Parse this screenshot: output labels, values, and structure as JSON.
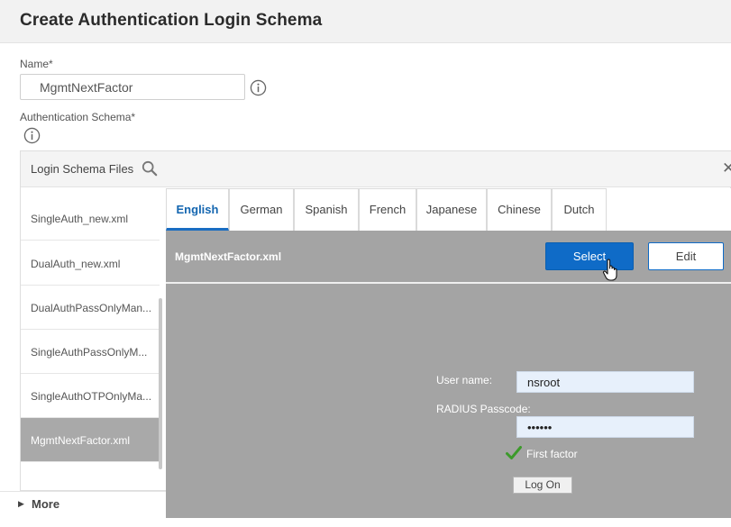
{
  "header": {
    "title": "Create Authentication Login Schema"
  },
  "form": {
    "name_label": "Name*",
    "name_value": "MgmtNextFactor",
    "schema_label": "Authentication Schema*"
  },
  "schema_panel": {
    "title": "Login Schema Files",
    "close_glyph": "✕",
    "files": [
      {
        "label": "SingleAuth_new.xml"
      },
      {
        "label": "DualAuth_new.xml"
      },
      {
        "label": "DualAuthPassOnlyMan..."
      },
      {
        "label": "SingleAuthPassOnlyM..."
      },
      {
        "label": "SingleAuthOTPOnlyMa..."
      },
      {
        "label": "MgmtNextFactor.xml"
      }
    ]
  },
  "preview": {
    "tabs": [
      {
        "label": "English"
      },
      {
        "label": "German"
      },
      {
        "label": "Spanish"
      },
      {
        "label": "French"
      },
      {
        "label": "Japanese"
      },
      {
        "label": "Chinese"
      },
      {
        "label": "Dutch"
      }
    ],
    "active_tab": "English",
    "file_name": "MgmtNextFactor.xml",
    "select_label": "Select",
    "edit_label": "Edit",
    "login_form": {
      "username_label": "User name:",
      "username_value": "nsroot",
      "passcode_label": "RADIUS Passcode:",
      "passcode_value": "••••••",
      "factor_text": "First factor",
      "logon_label": "Log On"
    }
  },
  "more": {
    "label": "More"
  },
  "colors": {
    "accent": "#0f6bc7",
    "preview_bg": "#a4a4a4",
    "selected_bg": "#a9a9a9",
    "check": "#3c9a2b"
  },
  "icons": [
    "info-icon",
    "search-icon",
    "close-icon",
    "check-icon",
    "cursor-icon",
    "triangle-right-icon"
  ]
}
